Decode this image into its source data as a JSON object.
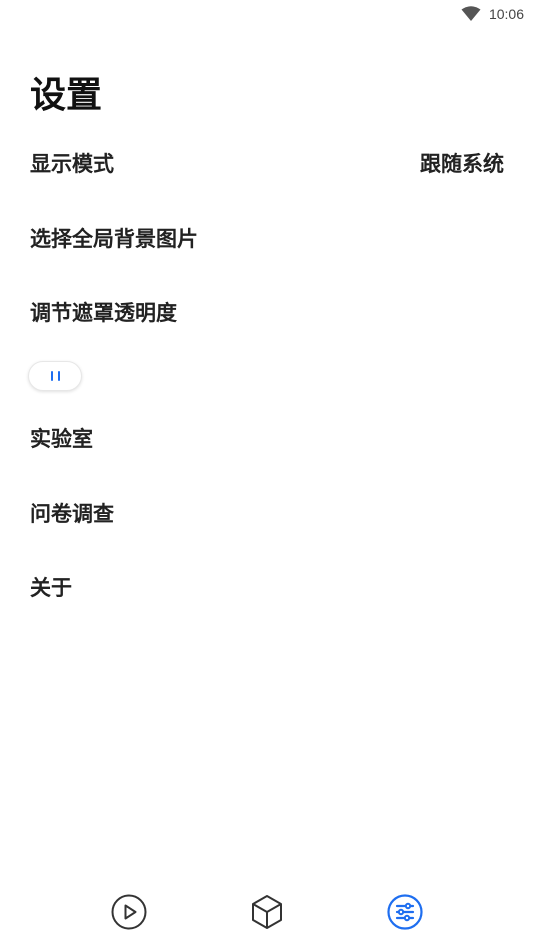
{
  "status_bar": {
    "time": "10:06",
    "wifi_icon": "wifi-icon"
  },
  "page": {
    "title": "设置"
  },
  "settings": {
    "display_mode": {
      "label": "显示模式",
      "value": "跟随系统"
    },
    "background": {
      "label": "选择全局背景图片"
    },
    "mask_opacity": {
      "label": "调节遮罩透明度",
      "slider_value": 0
    },
    "lab": {
      "label": "实验室"
    },
    "survey": {
      "label": "问卷调查"
    },
    "about": {
      "label": "关于"
    }
  },
  "bottom_nav": {
    "items": [
      {
        "icon": "play-circle-icon",
        "active": false
      },
      {
        "icon": "cube-icon",
        "active": false
      },
      {
        "icon": "settings-sliders-icon",
        "active": true
      }
    ],
    "active_color": "#1e6ef0",
    "inactive_color": "#333333"
  },
  "colors": {
    "accent": "#1e6ef0",
    "text": "#222222",
    "background": "#ffffff"
  }
}
